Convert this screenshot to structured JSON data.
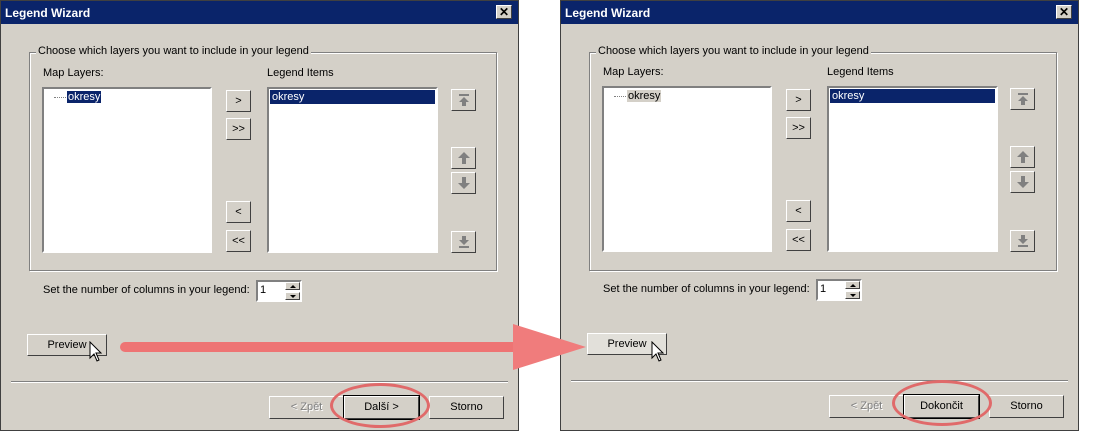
{
  "left_dialog": {
    "title": "Legend Wizard",
    "group_label": "Choose which layers you want to include in your legend",
    "map_layers_label": "Map Layers:",
    "legend_items_label": "Legend Items",
    "map_layers": [
      "okresy"
    ],
    "legend_items": [
      "okresy"
    ],
    "move_buttons": [
      ">",
      ">>",
      "<",
      "<<"
    ],
    "columns_label": "Set the number of columns in your legend:",
    "columns_value": "1",
    "preview_label": "Preview",
    "back_label": "< Zpět",
    "next_label": "Další >",
    "cancel_label": "Storno"
  },
  "right_dialog": {
    "title": "Legend Wizard",
    "group_label": "Choose which layers you want to include in your legend",
    "map_layers_label": "Map Layers:",
    "legend_items_label": "Legend Items",
    "map_layers": [
      "okresy"
    ],
    "legend_items": [
      "okresy"
    ],
    "move_buttons": [
      ">",
      ">>",
      "<",
      "<<"
    ],
    "columns_label": "Set the number of columns in your legend:",
    "columns_value": "1",
    "preview_label": "Preview",
    "back_label": "< Zpět",
    "finish_label": "Dokončit",
    "cancel_label": "Storno"
  },
  "annotation": {
    "color": "#e8686a",
    "arrow_color": "#f08080"
  },
  "icons": {
    "order_buttons": [
      "move-to-top-icon",
      "move-up-icon",
      "move-down-icon",
      "move-to-bottom-icon"
    ],
    "close": "close-icon",
    "cursor": "mouse-cursor-icon"
  }
}
